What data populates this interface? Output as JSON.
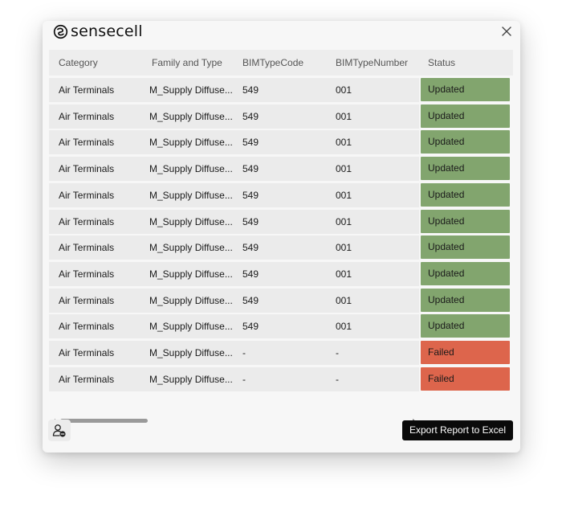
{
  "app": {
    "brand": "sensecell",
    "close_icon": "close-icon",
    "logo_icon": "sensecell-logo-icon"
  },
  "table": {
    "columns": [
      "Category",
      "Family and Type",
      "BIMTypeCode",
      "BIMTypeNumber",
      "Status"
    ],
    "rows": [
      {
        "category": "Air Terminals",
        "family": "M_Supply Diffuse...",
        "code": "549",
        "number": "001",
        "status": "Updated"
      },
      {
        "category": "Air Terminals",
        "family": "M_Supply Diffuse...",
        "code": "549",
        "number": "001",
        "status": "Updated"
      },
      {
        "category": "Air Terminals",
        "family": "M_Supply Diffuse...",
        "code": "549",
        "number": "001",
        "status": "Updated"
      },
      {
        "category": "Air Terminals",
        "family": "M_Supply Diffuse...",
        "code": "549",
        "number": "001",
        "status": "Updated"
      },
      {
        "category": "Air Terminals",
        "family": "M_Supply Diffuse...",
        "code": "549",
        "number": "001",
        "status": "Updated"
      },
      {
        "category": "Air Terminals",
        "family": "M_Supply Diffuse...",
        "code": "549",
        "number": "001",
        "status": "Updated"
      },
      {
        "category": "Air Terminals",
        "family": "M_Supply Diffuse...",
        "code": "549",
        "number": "001",
        "status": "Updated"
      },
      {
        "category": "Air Terminals",
        "family": "M_Supply Diffuse...",
        "code": "549",
        "number": "001",
        "status": "Updated"
      },
      {
        "category": "Air Terminals",
        "family": "M_Supply Diffuse...",
        "code": "549",
        "number": "001",
        "status": "Updated"
      },
      {
        "category": "Air Terminals",
        "family": "M_Supply Diffuse...",
        "code": "549",
        "number": "001",
        "status": "Updated"
      },
      {
        "category": "Air Terminals",
        "family": "M_Supply Diffuse...",
        "code": "-",
        "number": "-",
        "status": "Failed"
      },
      {
        "category": "Air Terminals",
        "family": "M_Supply Diffuse...",
        "code": "-",
        "number": "-",
        "status": "Failed"
      }
    ]
  },
  "status_colors": {
    "Updated": "#82a56e",
    "Failed": "#dd654c"
  },
  "footer": {
    "user_icon": "user-settings-icon",
    "export_label": "Export Report to Excel"
  }
}
